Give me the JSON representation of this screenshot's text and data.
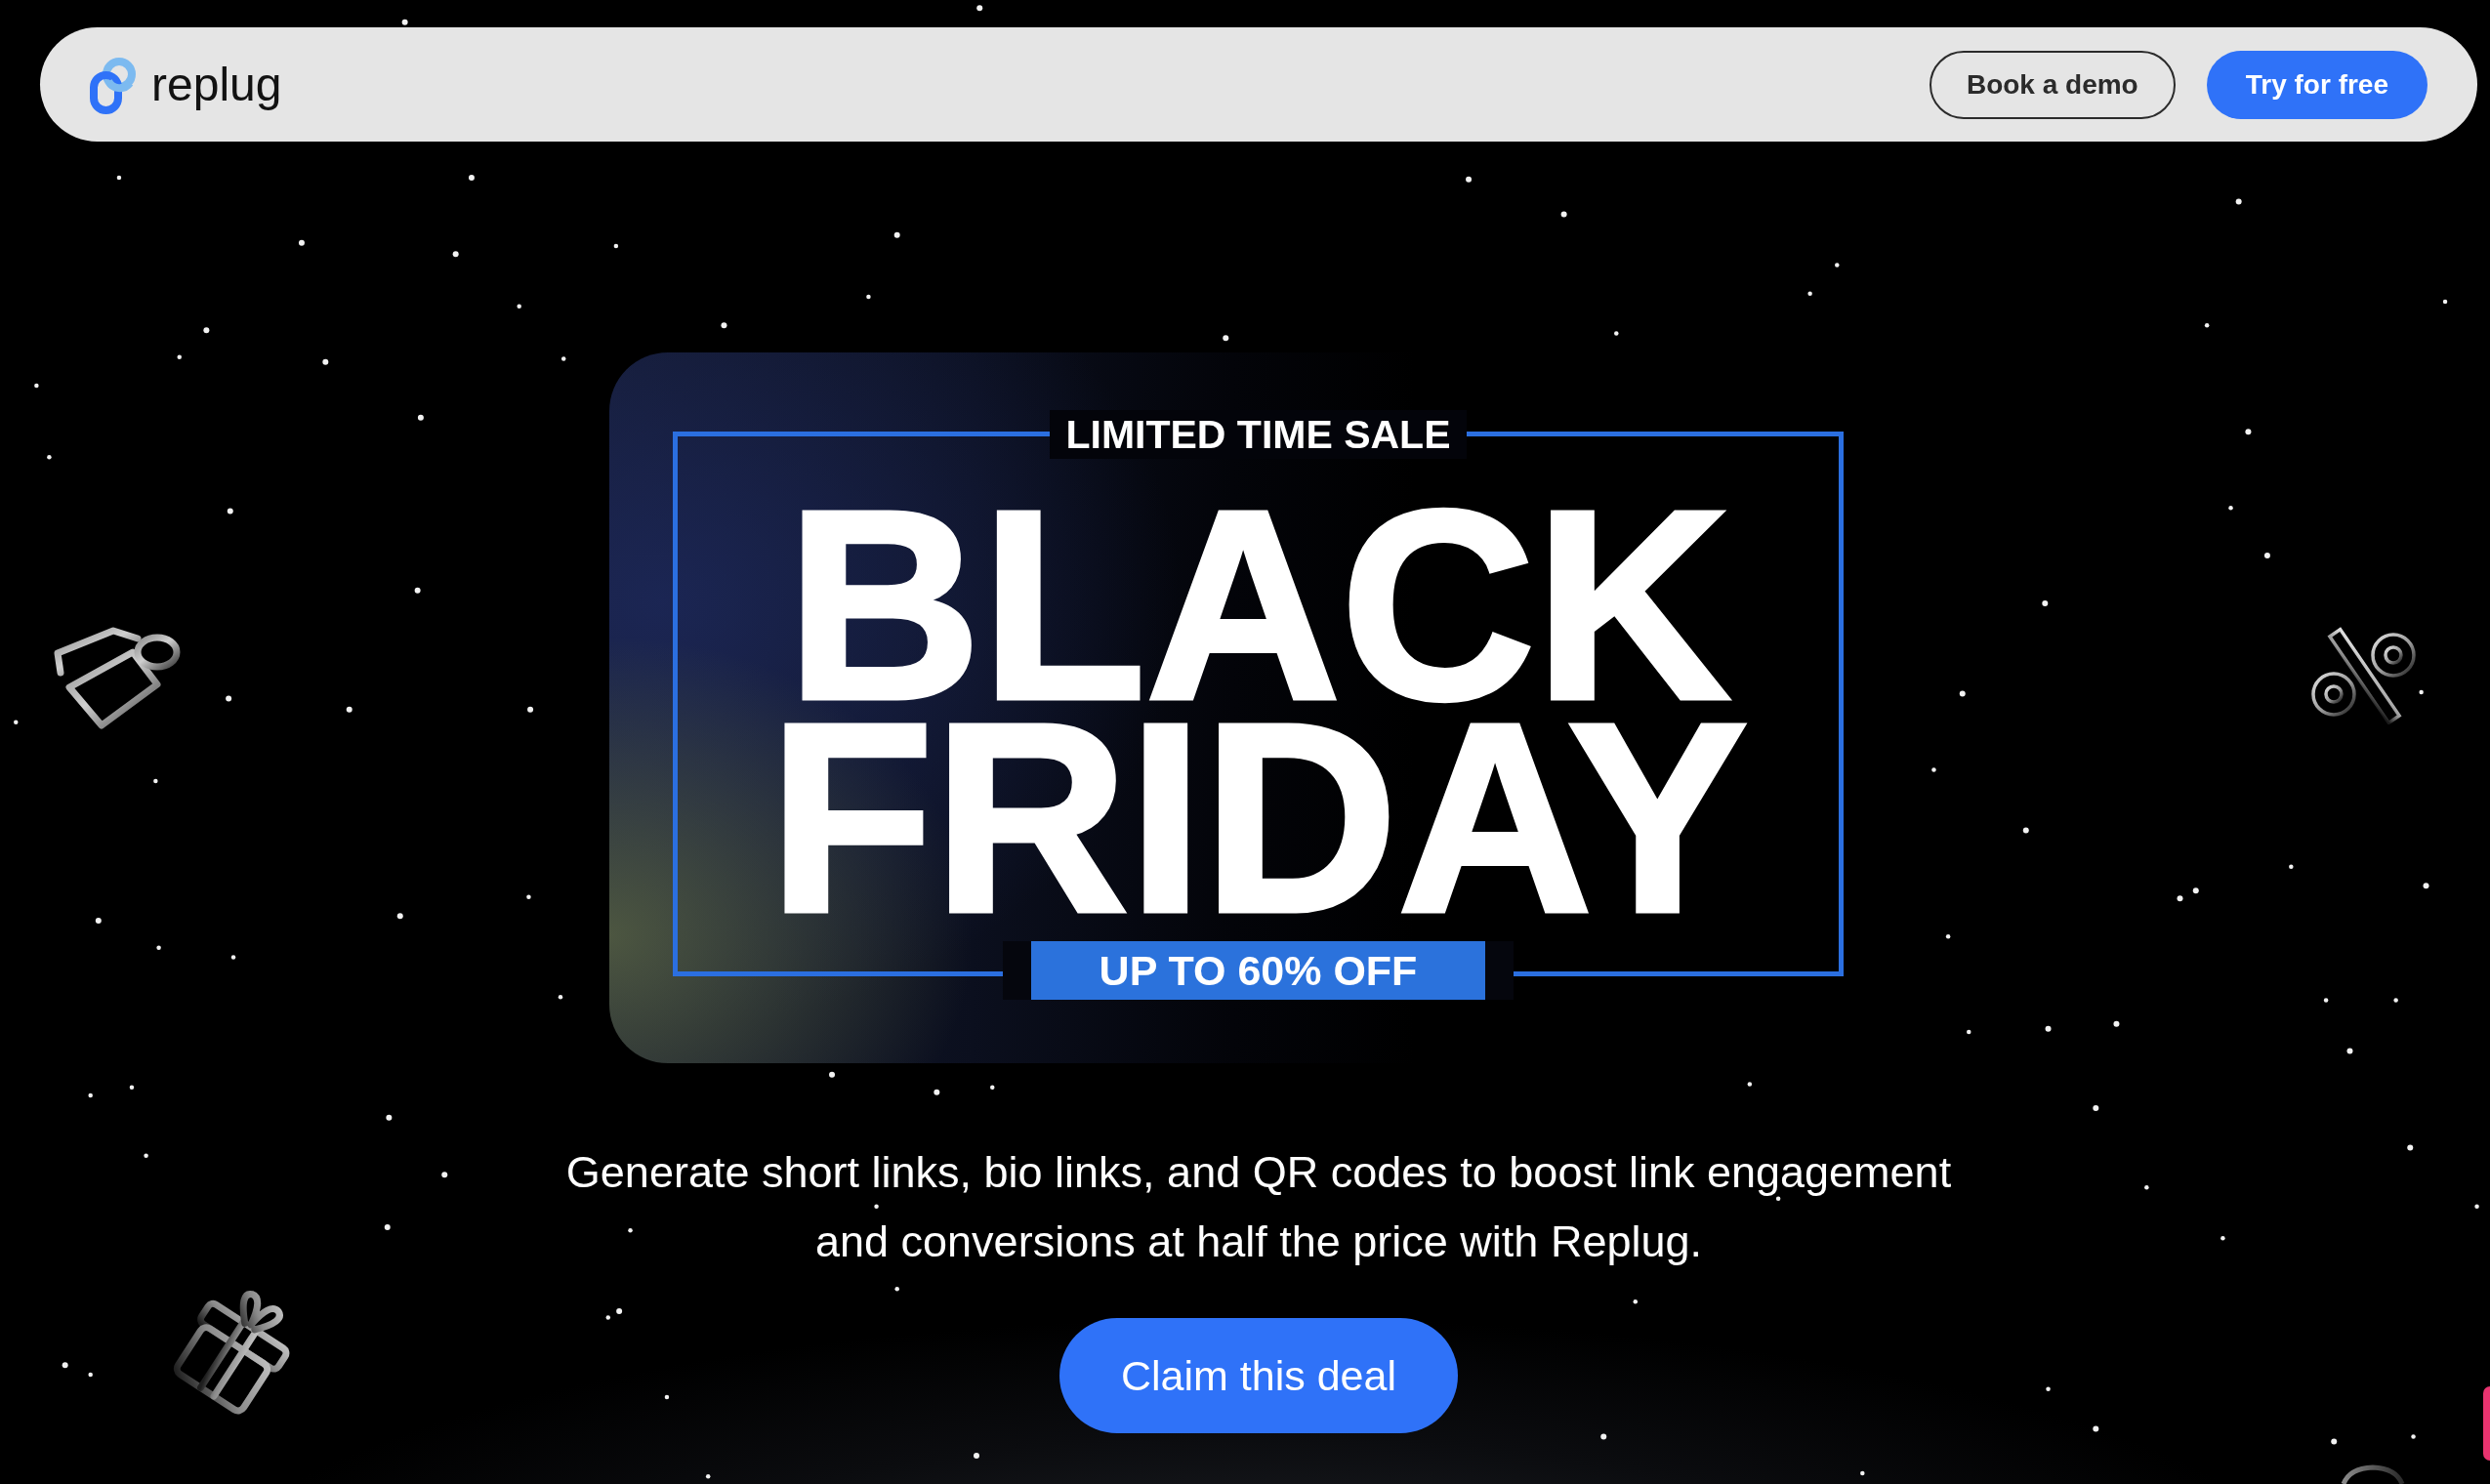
{
  "nav": {
    "logo_text": "replug",
    "buttons": [
      {
        "label": "Book a demo",
        "kind": "outline"
      },
      {
        "label": "Try for free",
        "kind": "filled"
      }
    ]
  },
  "banner": {
    "kicker": "LIMITED TIME SALE",
    "headline": "BLACK FRIDAY",
    "badge": "UP TO 60% OFF"
  },
  "description": "Generate short links, bio links, and QR codes to boost link engagement and conversions at half the price with Replug.",
  "cta": {
    "label": "Claim this deal"
  }
}
